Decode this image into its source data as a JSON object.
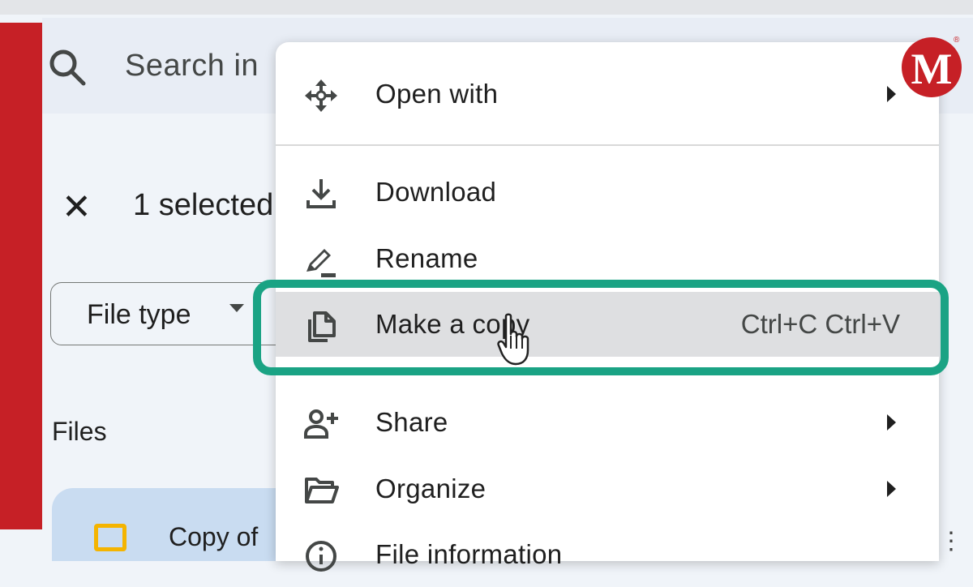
{
  "search": {
    "placeholder_text": "Search in"
  },
  "selection": {
    "close_icon_glyph": "✕",
    "count_text": "1 selected"
  },
  "filters": {
    "file_type_label": "File type"
  },
  "files": {
    "heading": "Files",
    "first_file_name": "Copy of",
    "more_glyph": "⋮"
  },
  "context_menu": {
    "items": [
      {
        "label": "Open with",
        "icon": "open-with-icon",
        "has_submenu": true
      },
      {
        "label": "Download",
        "icon": "download-icon",
        "has_submenu": false
      },
      {
        "label": "Rename",
        "icon": "rename-pencil-icon",
        "has_submenu": false
      },
      {
        "label": "Make a copy",
        "icon": "copy-icon",
        "shortcut": "Ctrl+C Ctrl+V",
        "highlighted": true
      },
      {
        "label": "Share",
        "icon": "add-person-icon",
        "has_submenu": true
      },
      {
        "label": "Organize",
        "icon": "folder-open-icon",
        "has_submenu": true
      },
      {
        "label": "File information",
        "icon": "info-icon",
        "has_submenu": true
      }
    ]
  },
  "overlay": {
    "highlight_color": "#1aa384",
    "logo_letter": "M",
    "logo_mark": "®",
    "logo_color": "#c62026"
  }
}
